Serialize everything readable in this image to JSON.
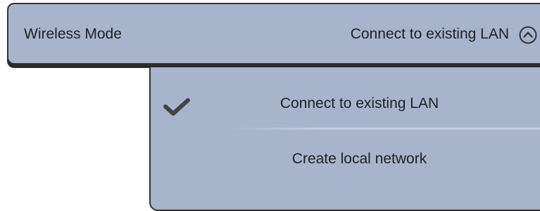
{
  "selector": {
    "label": "Wireless Mode",
    "value": "Connect to existing LAN",
    "icon": "chevron-up-circle-icon"
  },
  "dropdown": {
    "options": [
      {
        "label": "Connect to existing LAN",
        "selected": true
      },
      {
        "label": "Create local network",
        "selected": false
      }
    ]
  },
  "colors": {
    "panel": "#a8b4cc",
    "border": "#333333",
    "text": "#222222",
    "checkmark": "#444444"
  }
}
